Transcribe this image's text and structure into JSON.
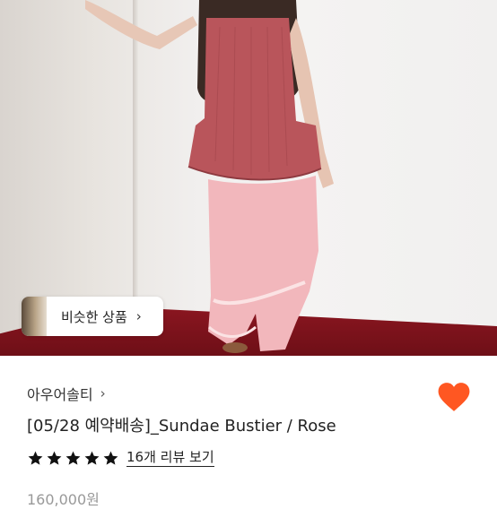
{
  "product_image": {
    "alt": "Model wearing rose bustier top and pink pants"
  },
  "similar_chip": {
    "label": "비슷한 상품",
    "icon": "chevron-right-icon"
  },
  "shop": {
    "name": "아우어솔티",
    "icon": "chevron-right-icon"
  },
  "favorite": {
    "icon": "heart-icon",
    "color": "#ff5722",
    "active": true
  },
  "product": {
    "title": "[05/28 예약배송]_Sundae Bustier / Rose",
    "rating_stars": 5,
    "review_link": "16개 리뷰 보기",
    "price": "160,000원"
  },
  "colors": {
    "accent": "#ff5722",
    "star": "#111111"
  }
}
